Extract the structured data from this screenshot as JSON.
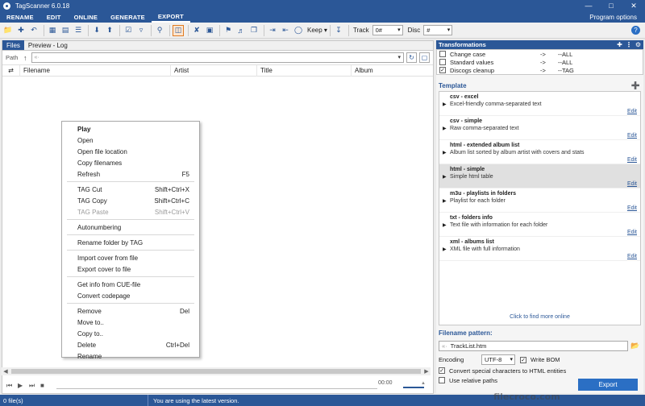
{
  "window": {
    "title": "TagScanner 6.0.18"
  },
  "menu": {
    "tabs": [
      "RENAME",
      "EDIT",
      "ONLINE",
      "GENERATE",
      "EXPORT"
    ],
    "active": "EXPORT",
    "program_options": "Program options"
  },
  "toolbar": {
    "keep_label": "Keep",
    "track_label": "Track",
    "track_value": "0#",
    "disc_label": "Disc",
    "disc_value": "#"
  },
  "left": {
    "tabs": [
      "Files",
      "Preview - Log"
    ],
    "path_label": "Path",
    "path_value": "«·",
    "columns": [
      "Filename",
      "Artist",
      "Title",
      "Album"
    ]
  },
  "player": {
    "time": "00:00"
  },
  "context_menu": {
    "play": "Play",
    "open": "Open",
    "open_location": "Open file location",
    "copy_filenames": "Copy filenames",
    "refresh": "Refresh",
    "refresh_key": "F5",
    "tag_cut": "TAG Cut",
    "tag_cut_key": "Shift+Ctrl+X",
    "tag_copy": "TAG Copy",
    "tag_copy_key": "Shift+Ctrl+C",
    "tag_paste": "TAG Paste",
    "tag_paste_key": "Shift+Ctrl+V",
    "autonumbering": "Autonumbering",
    "rename_folder": "Rename folder by TAG",
    "import_cover": "Import cover from file",
    "export_cover": "Export cover to file",
    "cue_info": "Get info from CUE-file",
    "convert_codepage": "Convert codepage",
    "remove": "Remove",
    "remove_key": "Del",
    "move_to": "Move to..",
    "copy_to": "Copy to..",
    "delete": "Delete",
    "delete_key": "Ctrl+Del",
    "rename": "Rename"
  },
  "transformations": {
    "title": "Transformations",
    "items": [
      {
        "name": "Change case",
        "arrow": "->",
        "target": "--ALL",
        "checked": false
      },
      {
        "name": "Standard values",
        "arrow": "->",
        "target": "--ALL",
        "checked": false
      },
      {
        "name": "Discogs cleanup",
        "arrow": "->",
        "target": "--TAG",
        "checked": true
      }
    ]
  },
  "template": {
    "title": "Template",
    "items": [
      {
        "name": "csv - excel",
        "desc": "Excel-friendly comma-separated text",
        "edit": "Edit"
      },
      {
        "name": "csv - simple",
        "desc": "Raw comma-separated text",
        "edit": "Edit"
      },
      {
        "name": "html - extended album list",
        "desc": "Album list sorted by album artist with covers and stats",
        "edit": "Edit"
      },
      {
        "name": "html - simple",
        "desc": "Simple html table",
        "edit": "Edit"
      },
      {
        "name": "m3u - playlists in folders",
        "desc": "Playlist for each folder",
        "edit": "Edit"
      },
      {
        "name": "txt - folders info",
        "desc": "Text file with information for each folder",
        "edit": "Edit"
      },
      {
        "name": "xml - albums list",
        "desc": "XML file with full information",
        "edit": "Edit"
      }
    ],
    "selected_index": 3,
    "find_more": "Click to find more online"
  },
  "export": {
    "pattern_label": "Filename pattern:",
    "pattern_prefix": "«·",
    "pattern_value": "TrackList.htm",
    "encoding_label": "Encoding",
    "encoding_value": "UTF-8",
    "write_bom": "Write BOM",
    "convert_special": "Convert special characters to HTML entities",
    "relative_paths": "Use relative paths",
    "export_button": "Export"
  },
  "status": {
    "files": "0 file(s)",
    "message": "You are using the latest version."
  },
  "watermark": "filecroco.com",
  "colors": {
    "accent": "#2b5797",
    "button": "#2b6fc4",
    "highlight": "#e07a20"
  }
}
